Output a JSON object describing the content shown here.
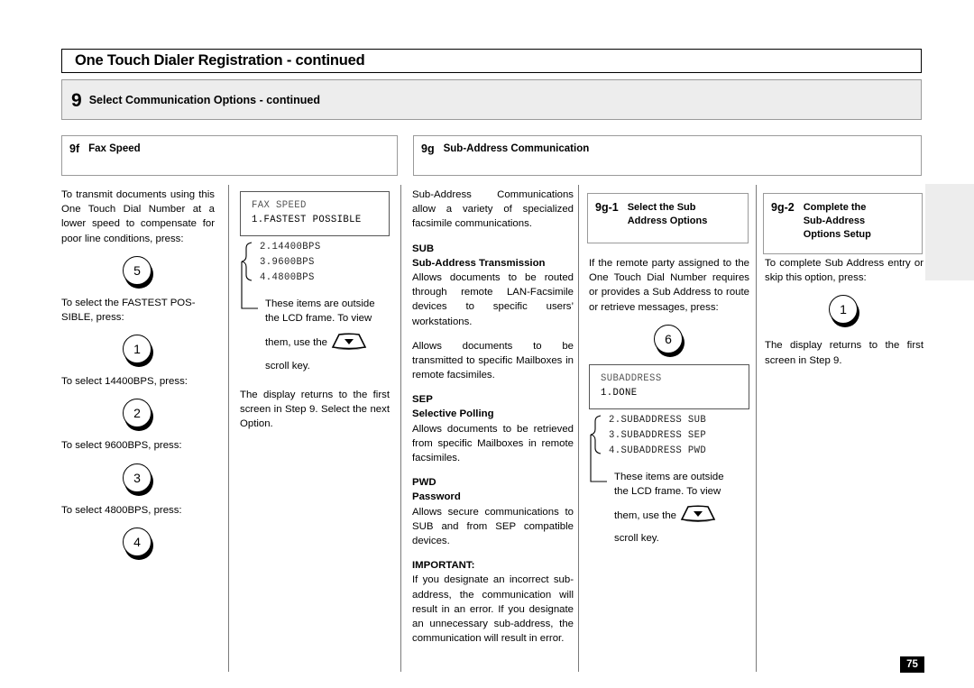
{
  "header": {
    "title": "One Touch Dialer Registration - continued",
    "step_number": "9",
    "step_label": "Select Communication Options - continued"
  },
  "sections": {
    "f": {
      "id": "9f",
      "label": "Fax Speed"
    },
    "g": {
      "id": "9g",
      "label": "Sub-Address Communication"
    },
    "g1": {
      "id": "9g-1",
      "label": "Select the Sub\nAddress Options"
    },
    "g2": {
      "id": "9g-2",
      "label": "Complete the\nSub-Address\nOptions Setup"
    }
  },
  "col1": {
    "intro": "To transmit documents using this One Touch Dial Number at a lower speed to compensate for poor line conditions, press:",
    "key1": "5",
    "t_fastest": "To select the FASTEST POS-SIBLE, press:",
    "key2": "1",
    "t_14400": "To select 14400BPS, press:",
    "key3": "2",
    "t_9600": "To select 9600BPS, press:",
    "key4": "3",
    "t_4800": "To select 4800BPS, press:",
    "key5": "4"
  },
  "col2": {
    "lcd_line1": "FAX SPEED",
    "lcd_line2": "1.FASTEST POSSIBLE",
    "outside_items": [
      "2.14400BPS",
      "3.9600BPS",
      "4.4800BPS"
    ],
    "note_a": "These items are outside",
    "note_b": "the LCD frame. To view",
    "note_c": "them, use the",
    "note_d": "scroll key.",
    "closing": "The display returns to the first screen in Step 9. Select the next Option."
  },
  "col3": {
    "intro": "Sub-Address Communications allow a variety of specialized facsimile communications.",
    "sub_abbr": "SUB",
    "sub_title": "Sub-Address Transmission",
    "sub_body1": "Allows documents to be routed through remote LAN-Facsimile devices to specific users’ workstations.",
    "sub_body2": "Allows documents to be transmitted to specific Mailboxes in remote facsimiles.",
    "sep_abbr": "SEP",
    "sep_title": "Selective Polling",
    "sep_body": "Allows documents to be retrieved from specific Mailboxes in remote facsimiles.",
    "pwd_abbr": "PWD",
    "pwd_title": "Password",
    "pwd_body": "Allows secure communications to SUB and from SEP compatible devices.",
    "important_title": "IMPORTANT:",
    "important_body": "If you designate an incorrect sub-address, the communication will result in an error. If you designate an unnecessary sub-address, the communication will result in error."
  },
  "col4": {
    "intro": "If the remote party assigned to the One Touch Dial Number requires or provides a Sub Address to route or retrieve messages, press:",
    "key": "6",
    "lcd_line1": "SUBADDRESS",
    "lcd_line2": "1.DONE",
    "outside_items": [
      "2.SUBADDRESS SUB",
      "3.SUBADDRESS SEP",
      "4.SUBADDRESS PWD"
    ],
    "note_a": "These items are outside",
    "note_b": "the LCD frame. To view",
    "note_c": "them, use the",
    "note_d": "scroll key."
  },
  "col5": {
    "intro": "To complete Sub Address entry or skip this option, press:",
    "key": "1",
    "closing": "The display returns to the first screen in Step 9."
  },
  "footer": {
    "page_number": "75"
  },
  "colors": {
    "band_gray": "#ededed",
    "rule_gray": "#9a9a9a",
    "ink": "#000000"
  }
}
